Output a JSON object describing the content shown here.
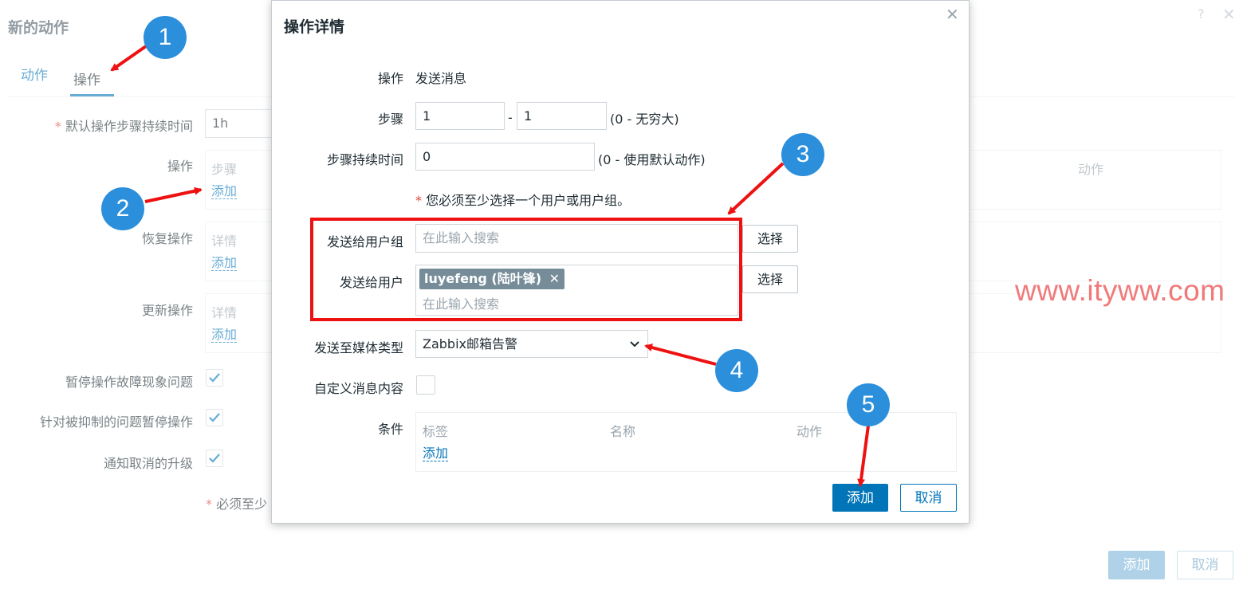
{
  "background": {
    "title": "新的动作",
    "help": "?",
    "close": "✕",
    "tabs": [
      "动作",
      "操作"
    ],
    "default_step_duration_label": "默认操作步骤持续时间",
    "default_step_duration_value": "1h",
    "operations_label": "操作",
    "operations_col_steps": "步骤",
    "operations_col_actions": "动作",
    "add_link": "添加",
    "recovery_label": "恢复操作",
    "details_col": "详情",
    "update_label": "更新操作",
    "pause_symptoms_label": "暂停操作故障现象问题",
    "pause_suppressed_label": "针对被抑制的问题暂停操作",
    "notify_cancelled_label": "通知取消的升级",
    "required_note": "必须至少",
    "add_button": "添加",
    "cancel_button": "取消"
  },
  "dialog": {
    "title": "操作详情",
    "close": "✕",
    "operation_label": "操作",
    "operation_value": "发送消息",
    "steps_label": "步骤",
    "steps_from": "1",
    "steps_sep": "-",
    "steps_to": "1",
    "steps_hint": "(0 - 无穷大)",
    "step_duration_label": "步骤持续时间",
    "step_duration_value": "0",
    "step_duration_hint": "(0 - 使用默认动作)",
    "required_note": "您必须至少选择一个用户或用户组。",
    "send_groups_label": "发送给用户组",
    "search_placeholder": "在此输入搜索",
    "select_button": "选择",
    "send_users_label": "发送给用户",
    "user_tag": "luyefeng (陆叶锋)",
    "media_type_label": "发送至媒体类型",
    "media_type_value": "Zabbix邮箱告警",
    "custom_message_label": "自定义消息内容",
    "conditions_label": "条件",
    "conditions_columns": [
      "标签",
      "名称",
      "动作"
    ],
    "add_link": "添加",
    "add_button": "添加",
    "cancel_button": "取消"
  },
  "annotations": [
    "1",
    "2",
    "3",
    "4",
    "5"
  ],
  "watermark": "www.ityww.com",
  "colors": {
    "primary": "#0275b8",
    "annotation_blue": "#2b8fdc",
    "annotation_red": "#ee1111",
    "watermark": "#f07a7a"
  }
}
